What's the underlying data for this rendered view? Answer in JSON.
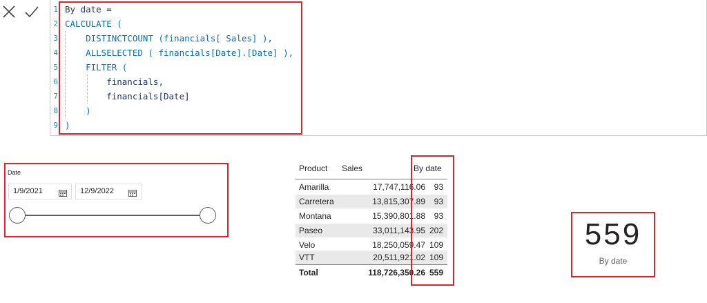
{
  "formula_bar": {
    "cancel_icon": "close-icon",
    "commit_icon": "check-icon",
    "line_numbers": [
      "1",
      "2",
      "3",
      "4",
      "5",
      "6",
      "7",
      "8",
      "9"
    ],
    "lines": [
      "By date =",
      "CALCULATE (",
      "    DISTINCTCOUNT (financials[ Sales] ),",
      "    ALLSELECTED ( financials[Date].[Date] ),",
      "    FILTER (",
      "        financials,",
      "        financials[Date]",
      "    )",
      ")"
    ]
  },
  "slicer": {
    "title": "Date",
    "start_date": "1/9/2021",
    "end_date": "12/9/2022",
    "calendar_icon": "calendar-icon",
    "range_fraction": [
      0,
      1
    ]
  },
  "table": {
    "headers": [
      "Product",
      "Sales",
      "By date"
    ],
    "rows": [
      {
        "product": "Amarilla",
        "sales": "17,747,116.06",
        "by_date": "93"
      },
      {
        "product": "Carretera",
        "sales": "13,815,307.89",
        "by_date": "93"
      },
      {
        "product": "Montana",
        "sales": "15,390,801.88",
        "by_date": "93"
      },
      {
        "product": "Paseo",
        "sales": "33,011,143.95",
        "by_date": "202"
      },
      {
        "product": "Velo",
        "sales": "18,250,059.47",
        "by_date": "109"
      },
      {
        "product": "VTT",
        "sales": "20,511,921.02",
        "by_date": "109"
      }
    ],
    "total": {
      "label": "Total",
      "sales": "118,726,350.26",
      "by_date": "559"
    }
  },
  "card": {
    "value": "559",
    "label": "By date"
  },
  "colors": {
    "highlight": "#e0232b",
    "table_rule": "#2f8fc9",
    "stripe": "#e9e9e9"
  }
}
